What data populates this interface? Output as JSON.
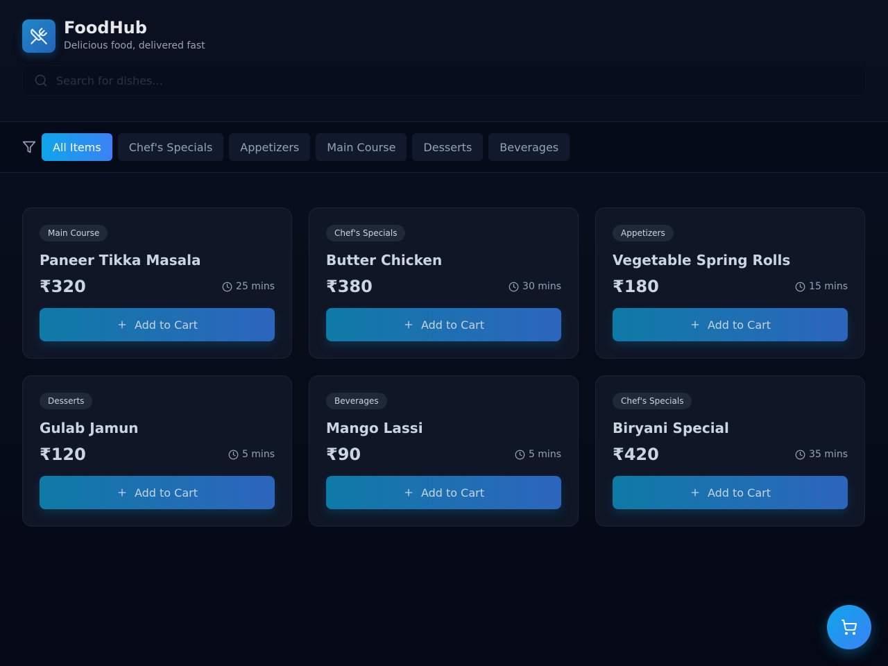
{
  "brand": {
    "title": "FoodHub",
    "tagline": "Delicious food, delivered fast",
    "icon": "utensils-icon"
  },
  "search": {
    "placeholder": "Search for dishes...",
    "value": ""
  },
  "filters": {
    "active": "All Items",
    "items": [
      "All Items",
      "Chef's Specials",
      "Appetizers",
      "Main Course",
      "Desserts",
      "Beverages"
    ]
  },
  "menu": [
    {
      "category": "Main Course",
      "name": "Paneer Tikka Masala",
      "price": "₹320",
      "time": "25 mins",
      "cta": "Add to Cart"
    },
    {
      "category": "Chef's Specials",
      "name": "Butter Chicken",
      "price": "₹380",
      "time": "30 mins",
      "cta": "Add to Cart"
    },
    {
      "category": "Appetizers",
      "name": "Vegetable Spring Rolls",
      "price": "₹180",
      "time": "15 mins",
      "cta": "Add to Cart"
    },
    {
      "category": "Desserts",
      "name": "Gulab Jamun",
      "price": "₹120",
      "time": "5 mins",
      "cta": "Add to Cart"
    },
    {
      "category": "Beverages",
      "name": "Mango Lassi",
      "price": "₹90",
      "time": "5 mins",
      "cta": "Add to Cart"
    },
    {
      "category": "Chef's Specials",
      "name": "Biryani Special",
      "price": "₹420",
      "time": "35 mins",
      "cta": "Add to Cart"
    }
  ],
  "cart": {
    "icon": "shopping-cart-icon"
  },
  "colors": {
    "accent": "#0ea5e9",
    "accent_secondary": "#3b82f6",
    "background": "#060b19",
    "card": "#0f1626"
  }
}
